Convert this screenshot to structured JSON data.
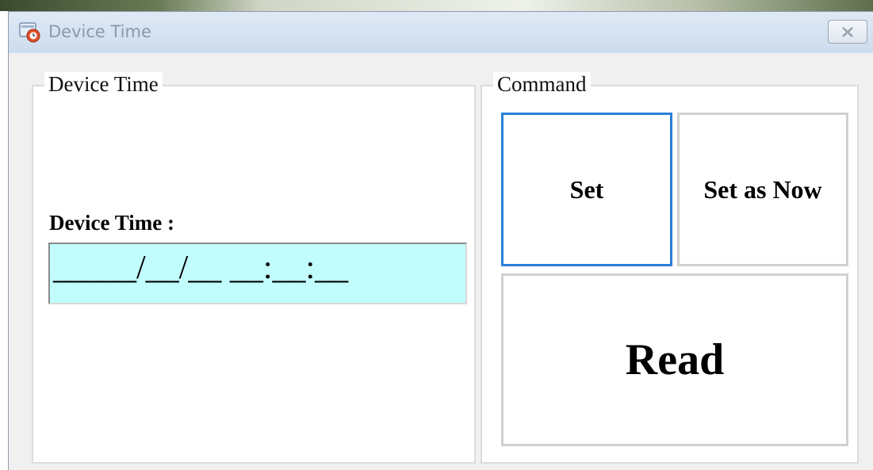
{
  "window": {
    "title": "Device Time",
    "close_icon": "close-x-icon",
    "app_icon": "device-time-app-icon"
  },
  "device_time_group": {
    "legend": "Device Time",
    "field_label": "Device Time :",
    "field_value": "_____/__/__ __:__:__"
  },
  "command_group": {
    "legend": "Command",
    "set_label": "Set",
    "set_as_now_label": "Set as Now",
    "read_label": "Read"
  },
  "colors": {
    "field_background": "#c1fdfd",
    "focus_border": "#2b7fd8"
  }
}
